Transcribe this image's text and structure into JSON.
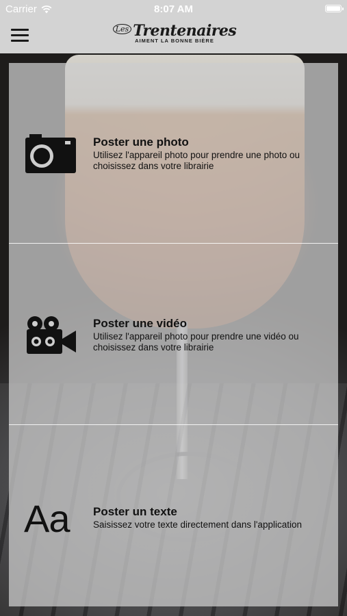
{
  "status_bar": {
    "carrier": "Carrier",
    "time": "8:07 AM"
  },
  "nav": {
    "logo": {
      "les": "Les",
      "brand": "Trentenaires",
      "tagline": "AIMENT LA BONNE BIÈRE"
    }
  },
  "options": [
    {
      "title": "Poster une photo",
      "description": "Utilisez l'appareil photo pour prendre une photo ou choisissez dans votre librairie",
      "icon": "camera-icon"
    },
    {
      "title": "Poster une vidéo",
      "description": "Utilisez l'appareil photo pour prendre une vidéo ou choisissez dans votre librairie",
      "icon": "video-camera-icon"
    },
    {
      "title": "Poster un texte",
      "description": "Saisissez votre texte directement dans l'application",
      "icon": "text-icon",
      "icon_glyph": "Aa"
    }
  ],
  "colors": {
    "bar_background": "#d3d3d3",
    "panel_overlay": "rgba(205,205,205,0.74)",
    "text": "#111111"
  }
}
